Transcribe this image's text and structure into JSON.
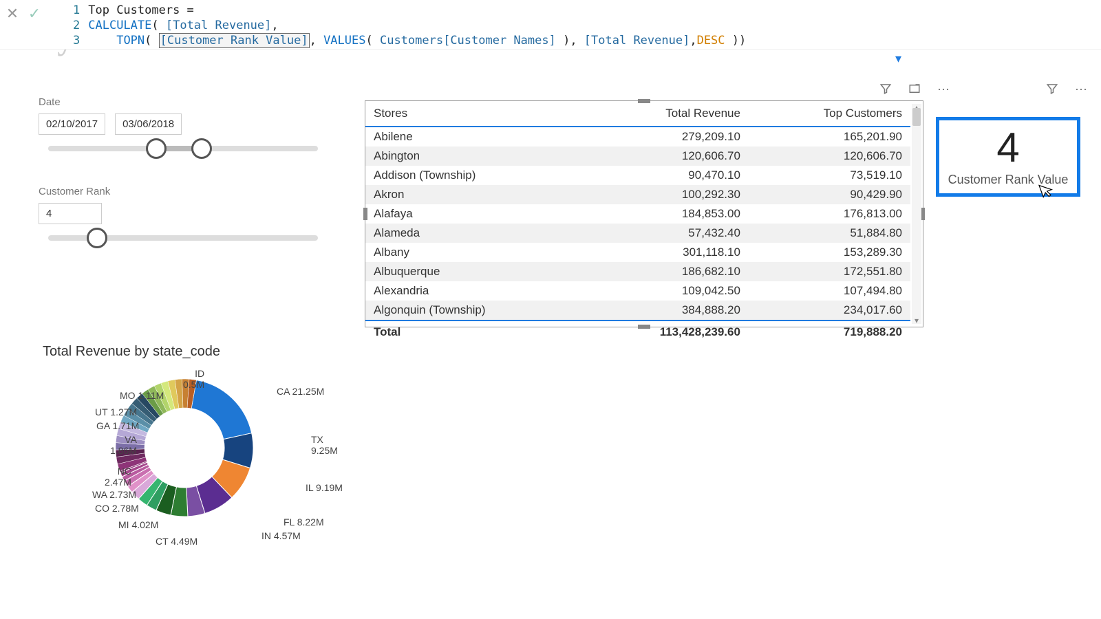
{
  "formula": {
    "lines": [
      "1",
      "2",
      "3"
    ],
    "measure_name": "Top Customers",
    "code_line1_name": "Top Customers =",
    "code_line2_calc": "CALCULATE",
    "code_line2_open": "( ",
    "code_line2_measure": "[Total Revenue]",
    "code_line2_close": ",",
    "code_line3_indent": "    ",
    "code_line3_topn": "TOPN",
    "code_line3_p1": "( ",
    "code_line3_rankval": "[Customer Rank Value]",
    "code_line3_c1": ", ",
    "code_line3_values": "VALUES",
    "code_line3_p2": "( ",
    "code_line3_col": "Customers[Customer Names]",
    "code_line3_p2e": " ), ",
    "code_line3_meas2": "[Total Revenue]",
    "code_line3_c2": ",",
    "code_line3_desc": "DESC",
    "code_line3_end": " ))"
  },
  "watermark": "Dy",
  "icons": {
    "filter": "⛉",
    "focus": "⧉",
    "more": "⋯",
    "dropdown": "▾"
  },
  "slicers": {
    "date": {
      "title": "Date",
      "from": "02/10/2017",
      "to": "03/06/2018",
      "thumb1_pct": 40,
      "thumb2_pct": 57
    },
    "rank": {
      "title": "Customer Rank",
      "value": "4",
      "thumb_pct": 18
    }
  },
  "table": {
    "headers": [
      "Stores",
      "Total Revenue",
      "Top Customers"
    ],
    "rows": [
      {
        "store": "Abilene",
        "revenue": "279,209.10",
        "top": "165,201.90"
      },
      {
        "store": "Abington",
        "revenue": "120,606.70",
        "top": "120,606.70"
      },
      {
        "store": "Addison (Township)",
        "revenue": "90,470.10",
        "top": "73,519.10"
      },
      {
        "store": "Akron",
        "revenue": "100,292.30",
        "top": "90,429.90"
      },
      {
        "store": "Alafaya",
        "revenue": "184,853.00",
        "top": "176,813.00"
      },
      {
        "store": "Alameda",
        "revenue": "57,432.40",
        "top": "51,884.80"
      },
      {
        "store": "Albany",
        "revenue": "301,118.10",
        "top": "153,289.30"
      },
      {
        "store": "Albuquerque",
        "revenue": "186,682.10",
        "top": "172,551.80"
      },
      {
        "store": "Alexandria",
        "revenue": "109,042.50",
        "top": "107,494.80"
      },
      {
        "store": "Algonquin (Township)",
        "revenue": "384,888.20",
        "top": "234,017.60"
      }
    ],
    "total_label": "Total",
    "total_revenue": "113,428,239.60",
    "total_top": "719,888.20"
  },
  "card": {
    "value": "4",
    "label": "Customer Rank Value"
  },
  "chart_data": {
    "type": "pie",
    "title": "Total Revenue by state_code",
    "unit": "M",
    "slices": [
      {
        "label": "CA",
        "value": 21.25,
        "text": "CA 21.25M",
        "color": "#1f77d4"
      },
      {
        "label": "TX",
        "value": 9.25,
        "text": "TX\n9.25M",
        "color": "#17447f"
      },
      {
        "label": "IL",
        "value": 9.19,
        "text": "IL 9.19M",
        "color": "#ef8632"
      },
      {
        "label": "FL",
        "value": 8.22,
        "text": "FL 8.22M",
        "color": "#5b2d91"
      },
      {
        "label": "IN",
        "value": 4.57,
        "text": "IN 4.57M",
        "color": "#7a4fa3"
      },
      {
        "label": "CT",
        "value": 4.49,
        "text": "CT 4.49M",
        "color": "#2e7d32"
      },
      {
        "label": "MI",
        "value": 4.02,
        "text": "MI 4.02M",
        "color": "#1b5e20"
      },
      {
        "label": "CO",
        "value": 2.78,
        "text": "CO 2.78M",
        "color": "#2e9e61"
      },
      {
        "label": "WA",
        "value": 2.73,
        "text": "WA 2.73M",
        "color": "#35b56f"
      },
      {
        "label": "NC",
        "value": 2.47,
        "text": "NC\n2.47M",
        "color": "#d9a8d9"
      },
      {
        "label": "VA",
        "value": 1.86,
        "text": "VA\n1.86M",
        "color": "#e091c8"
      },
      {
        "label": "GA",
        "value": 1.71,
        "text": "GA 1.71M",
        "color": "#c96fb0"
      },
      {
        "label": "UT",
        "value": 1.27,
        "text": "UT 1.27M",
        "color": "#b85a9f"
      },
      {
        "label": "MO",
        "value": 1.11,
        "text": "MO 1.11M",
        "color": "#a4478c"
      },
      {
        "label": "ID",
        "value": 0.5,
        "text": "ID\n0.5M",
        "color": "#8e3478"
      }
    ],
    "other_fill": 37.58
  }
}
